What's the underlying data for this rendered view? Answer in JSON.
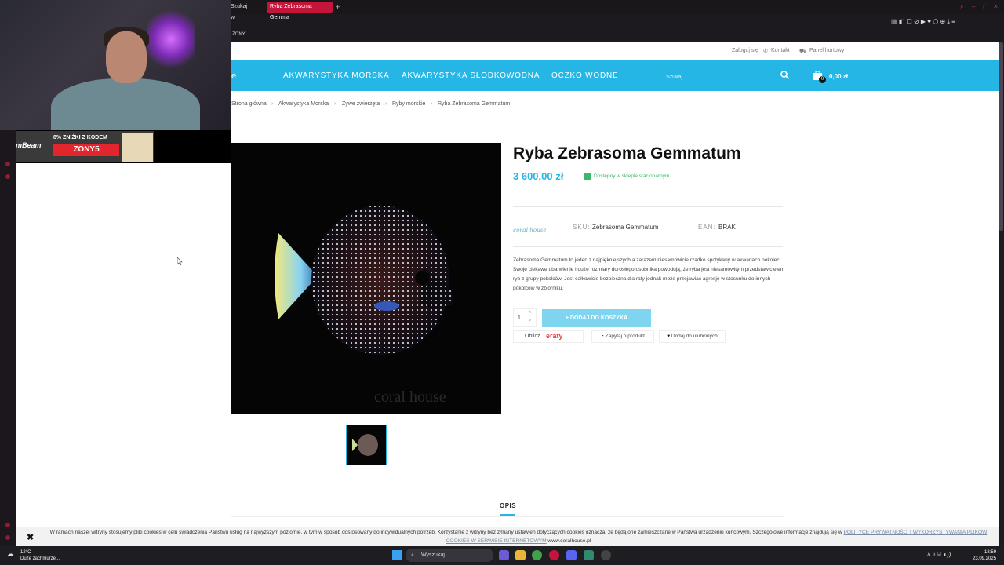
{
  "browser": {
    "tabs": [
      {
        "label": "Szukaj w"
      },
      {
        "label": "Ryba Zebrasoma Gemma"
      }
    ],
    "new_tab": "+",
    "bookmark": "ZONY"
  },
  "stream": {
    "promo_brand": "GymBeam",
    "promo_text": "8% ZNIŻKI Z KODEM",
    "promo_code": "ZONY5"
  },
  "site": {
    "top_links": {
      "login": "Zaloguj się",
      "contact": "Kontakt",
      "wholesale": "Panel hurtowy"
    },
    "nav": [
      "AKWARYSTYKA MORSKA",
      "AKWARYSTYKA SŁODKOWODNA",
      "OCZKO WODNE"
    ],
    "logo_fragment": "e",
    "search_placeholder": "Szukaj...",
    "cart": {
      "count": "0",
      "total": "0,00 zł"
    },
    "breadcrumb": [
      "Strona główna",
      "Akwarystyka Morska",
      "Żywe zwierzęta",
      "Ryby morskie",
      "Ryba Zebrasoma Gemmatum"
    ],
    "product": {
      "title": "Ryba Zebrasoma Gemmatum",
      "price": "3 600,00 zł",
      "stock": "Dostępny w sklepie stacjonarnym",
      "brand_logo": "coral house",
      "sku_label": "SKU:",
      "sku": "Zebrasoma Gemmatum",
      "ean_label": "EAN:",
      "ean": "BRAK",
      "description": "Zebrasoma Gemmatum to jeden z najpiękniejszych a zarazem niesamowicie rzadko spotykany w akwariach pokolec. Swoje ciekawe ubarwienie i duże rozmiary dorosłego osobnika powodują, że ryba jest niesamowitym przedstawicielem ryb z grupy pokolców. Jest całkowicie bezpieczna dla rafy jednak może przejawiać agresję w stosunku do innych pokolców w zbiorniku.",
      "quantity": "1",
      "add_to_cart": "+ DODAJ DO KOSZYKA",
      "calc_label": "Oblicz",
      "eraty": "eraty",
      "ask": "Zapytaj o produkt",
      "favorite": "Dodaj do ulubionych",
      "watermark": "coral house",
      "tab_description": "OPIS"
    },
    "cookie": {
      "text": "W ramach naszej witryny stosujemy pliki cookies w celu świadczenia Państwu usług na najwyższym poziomie, w tym w sposób dostosowany do indywidualnych potrzeb. Korzystanie z witryny bez zmiany ustawień dotyczących cookies oznacza, że będą one zamieszczane w Państwa urządzeniu końcowym. Szczegółowe informacje znajdują się w",
      "link": "POLITYCE PRYWATNOŚCI I WYKORZYSTYWANIA PLIKÓW COOKIES W SERWISIE INTERNETOWYM",
      "domain": "www.coralhouse.pl",
      "close": "✖"
    }
  },
  "taskbar": {
    "weather_temp": "12°C",
    "weather_desc": "Duże zachmurze...",
    "search": "Wyszukaj",
    "time": "18:59",
    "date": "23.09.2025"
  },
  "colors": {
    "accent": "#26b6e5",
    "chrome_red": "#c4163a",
    "price": "#26b6e5"
  }
}
